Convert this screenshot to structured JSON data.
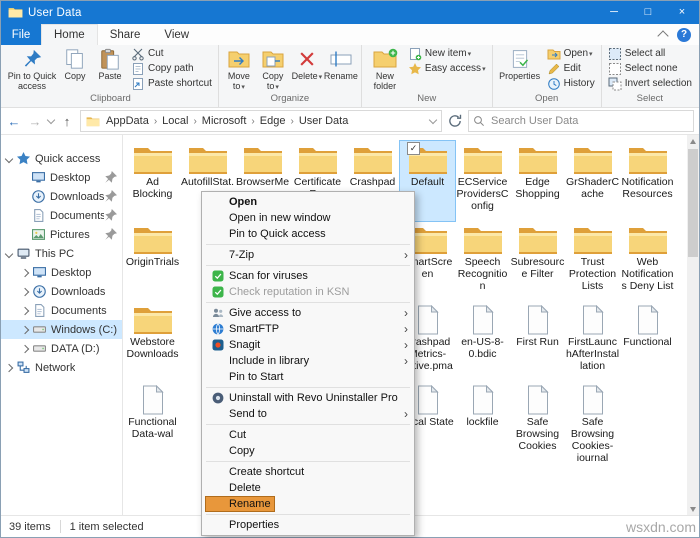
{
  "window": {
    "title": "User Data",
    "controls": {
      "minimize": "─",
      "maximize": "□",
      "close": "×"
    }
  },
  "colors": {
    "titlebar": "#1677d2",
    "selection": "#cce8ff",
    "menu_highlight": "#e8973b",
    "folder": "#f5cf6e"
  },
  "ribbon": {
    "file_tab": "File",
    "tabs": [
      "Home",
      "Share",
      "View"
    ],
    "active_tab": "Home",
    "clipboard": {
      "label": "Clipboard",
      "pin": "Pin to Quick access",
      "copy": "Copy",
      "paste": "Paste",
      "cut": "Cut",
      "copy_path": "Copy path",
      "paste_shortcut": "Paste shortcut"
    },
    "organize": {
      "label": "Organize",
      "move_to": "Move to",
      "copy_to": "Copy to",
      "delete": "Delete",
      "rename": "Rename"
    },
    "new_group": {
      "label": "New",
      "new_folder": "New folder",
      "new_item": "New item",
      "easy_access": "Easy access"
    },
    "open_group": {
      "label": "Open",
      "properties": "Properties",
      "open": "Open",
      "edit": "Edit",
      "history": "History"
    },
    "select_group": {
      "label": "Select",
      "select_all": "Select all",
      "select_none": "Select none",
      "invert_selection": "Invert selection"
    }
  },
  "address": {
    "crumbs": [
      "AppData",
      "Local",
      "Microsoft",
      "Edge",
      "User Data"
    ],
    "search_placeholder": "Search User Data"
  },
  "sidebar": {
    "items": [
      {
        "label": "Quick access",
        "icon": "star",
        "level": 0,
        "chev": "down"
      },
      {
        "label": "Desktop",
        "icon": "desktop",
        "level": 1,
        "pinned": true
      },
      {
        "label": "Downloads",
        "icon": "downloads",
        "level": 1,
        "pinned": true
      },
      {
        "label": "Documents",
        "icon": "document",
        "level": 1,
        "pinned": true
      },
      {
        "label": "Pictures",
        "icon": "pictures",
        "level": 1,
        "pinned": true
      },
      {
        "label": "This PC",
        "icon": "pc",
        "level": 0,
        "chev": "down"
      },
      {
        "label": "Desktop",
        "icon": "desktop",
        "level": 1,
        "chev": "right"
      },
      {
        "label": "Downloads",
        "icon": "downloads",
        "level": 1,
        "chev": "right"
      },
      {
        "label": "Documents",
        "icon": "document",
        "level": 1,
        "chev": "right"
      },
      {
        "label": "Windows (C:)",
        "icon": "drive",
        "level": 1,
        "chev": "right",
        "selected": true
      },
      {
        "label": "DATA (D:)",
        "icon": "drive",
        "level": 1,
        "chev": "right"
      },
      {
        "label": "Network",
        "icon": "network",
        "level": 0,
        "chev": "right"
      }
    ]
  },
  "files": {
    "items": [
      {
        "name": "Ad Blocking",
        "type": "folder",
        "col": 1,
        "row": 1
      },
      {
        "name": "AutofillStat...",
        "type": "folder",
        "col": 2,
        "row": 1
      },
      {
        "name": "BrowserMe...",
        "type": "folder",
        "col": 3,
        "row": 1
      },
      {
        "name": "CertificateR...",
        "type": "folder",
        "col": 4,
        "row": 1
      },
      {
        "name": "Crashpad",
        "type": "folder",
        "col": 5,
        "row": 1
      },
      {
        "name": "Default",
        "type": "folder",
        "col": 6,
        "row": 1,
        "selected": true
      },
      {
        "name": "ECServiceProvidersConfig",
        "type": "folder",
        "col": 7,
        "row": 1
      },
      {
        "name": "Edge Shopping",
        "type": "folder",
        "col": 8,
        "row": 1
      },
      {
        "name": "GrShaderCache",
        "type": "folder",
        "col": 9,
        "row": 1
      },
      {
        "name": "Notification Resources",
        "type": "folder",
        "col": 10,
        "row": 1
      },
      {
        "name": "OriginTrials",
        "type": "folder",
        "col": 1,
        "row": 2
      },
      {
        "name": "SmartScreen",
        "type": "folder",
        "col": 6,
        "row": 2
      },
      {
        "name": "Speech Recognition",
        "type": "folder",
        "col": 7,
        "row": 2
      },
      {
        "name": "Subresource Filter",
        "type": "folder",
        "col": 8,
        "row": 2
      },
      {
        "name": "Trust Protection Lists",
        "type": "folder",
        "col": 9,
        "row": 2
      },
      {
        "name": "Web Notifications Deny List",
        "type": "folder",
        "col": 10,
        "row": 2
      },
      {
        "name": "Webstore Downloads",
        "type": "folder",
        "col": 1,
        "row": 3
      },
      {
        "name": "CrashpadMetrics-active.pma",
        "type": "file",
        "col": 6,
        "row": 3
      },
      {
        "name": "en-US-8-0.bdic",
        "type": "file",
        "col": 7,
        "row": 3
      },
      {
        "name": "First Run",
        "type": "file",
        "col": 8,
        "row": 3
      },
      {
        "name": "FirstLaunchAfterInstallation",
        "type": "file",
        "col": 9,
        "row": 3
      },
      {
        "name": "Functional",
        "type": "file",
        "col": 10,
        "row": 3
      },
      {
        "name": "Functional Data-wal",
        "type": "file",
        "col": 1,
        "row": 4
      },
      {
        "name": "Local State",
        "type": "file",
        "col": 6,
        "row": 4
      },
      {
        "name": "lockfile",
        "type": "file",
        "col": 7,
        "row": 4
      },
      {
        "name": "Safe Browsing Cookies",
        "type": "file",
        "col": 8,
        "row": 4
      },
      {
        "name": "Safe Browsing Cookies-journal",
        "type": "file",
        "col": 9,
        "row": 4
      }
    ]
  },
  "context_menu": {
    "items": [
      {
        "label": "Open",
        "bold": true
      },
      {
        "label": "Open in new window"
      },
      {
        "label": "Pin to Quick access"
      },
      {
        "type": "separator"
      },
      {
        "label": "7-Zip",
        "submenu": true
      },
      {
        "type": "separator"
      },
      {
        "label": "Scan for viruses",
        "icon": "kaspersky"
      },
      {
        "label": "Check reputation in KSN",
        "icon": "kaspersky",
        "disabled": true
      },
      {
        "type": "separator"
      },
      {
        "label": "Give access to",
        "submenu": true,
        "icon": "give-access"
      },
      {
        "label": "SmartFTP",
        "submenu": true,
        "icon": "smartftp"
      },
      {
        "label": "Snagit",
        "submenu": true,
        "icon": "snagit"
      },
      {
        "label": "Include in library",
        "submenu": true
      },
      {
        "label": "Pin to Start"
      },
      {
        "type": "separator"
      },
      {
        "label": "Uninstall with Revo Uninstaller Pro",
        "icon": "revo"
      },
      {
        "label": "Send to",
        "submenu": true
      },
      {
        "type": "separator"
      },
      {
        "label": "Cut"
      },
      {
        "label": "Copy"
      },
      {
        "type": "separator"
      },
      {
        "label": "Create shortcut"
      },
      {
        "label": "Delete"
      },
      {
        "label": "Rename",
        "highlight": true
      },
      {
        "type": "separator"
      },
      {
        "label": "Properties"
      }
    ]
  },
  "status": {
    "items_count": "39 items",
    "selected": "1 item selected"
  },
  "watermark": "wsxdn.com"
}
